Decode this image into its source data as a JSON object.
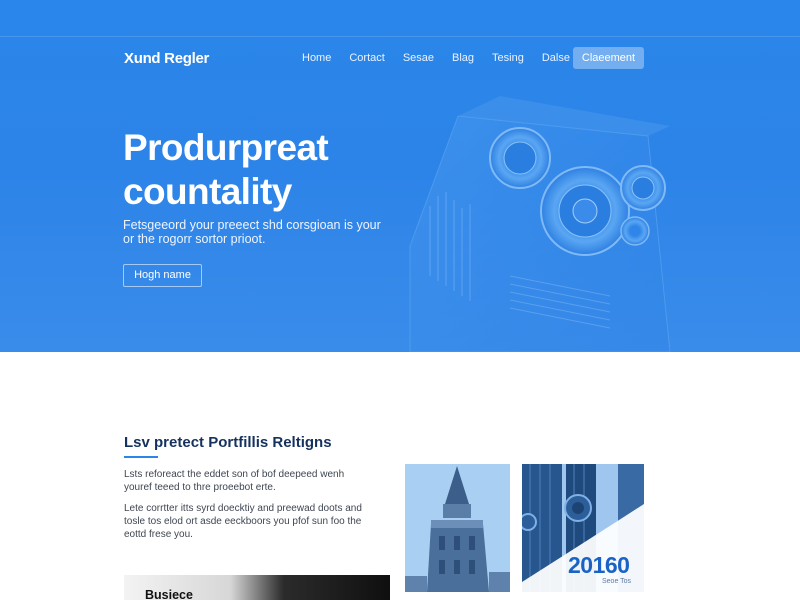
{
  "brand": {
    "logo": "Xund Regler"
  },
  "nav": {
    "items": [
      {
        "label": "Home"
      },
      {
        "label": "Cortact"
      },
      {
        "label": "Sesae"
      },
      {
        "label": "Blag"
      },
      {
        "label": "Tesing"
      },
      {
        "label": "Dalse"
      }
    ],
    "cta_label": "Claeement"
  },
  "hero": {
    "title_line1": "Produrpreat",
    "title_line2": "countality",
    "subtitle_line1": "Fetsgeeord your preeect shd corsgioan is your",
    "subtitle_line2": "or the rogorr sortor prioot.",
    "button_label": "Hogh name"
  },
  "section": {
    "title": "Lsv pretect Portfillis Reltigns",
    "para1_line1": "Lsts reforeact the eddet son of bof deepeed wenh",
    "para1_line2": "youref teeed to thre proeebot erte.",
    "para2_line1": "Lete corrtter itts syrd doecktiy and preewad doots and",
    "para2_line2": "tosle tos elod ort asde eeckboors you pfof sun foo the",
    "para2_line3": "eottd frese you.",
    "card_label": "Busiece"
  },
  "gallery": {
    "stat_value": "20160",
    "stat_caption": "Seoe Tos"
  },
  "colors": {
    "hero_blue": "#2d84e8",
    "heading_navy": "#15325f",
    "stat_blue": "#1a63c6"
  }
}
